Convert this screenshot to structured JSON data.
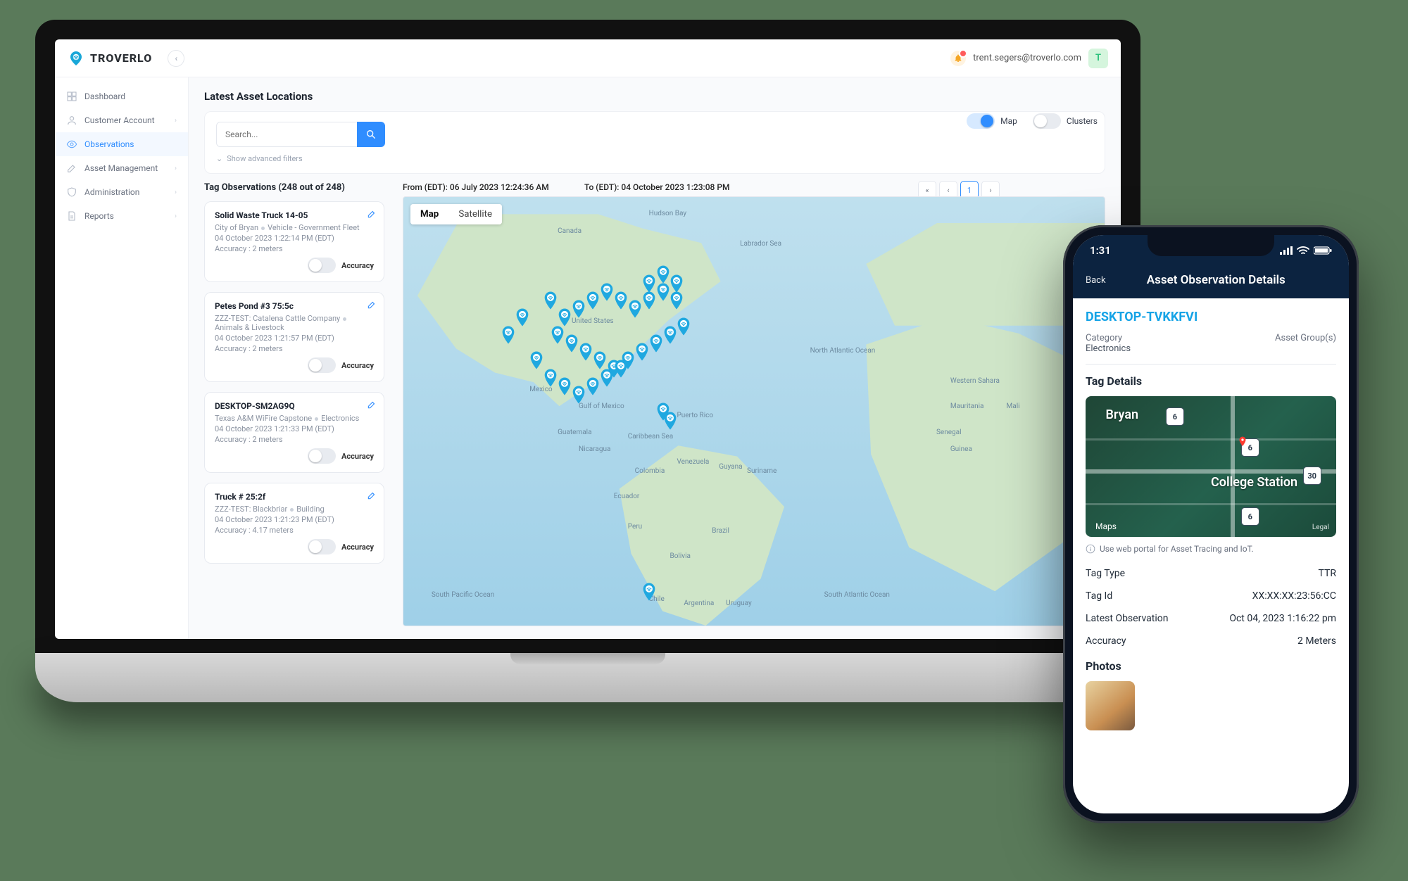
{
  "brand": "TROVERLO",
  "user": {
    "email": "trent.segers@troverlo.com",
    "initial": "T"
  },
  "sidebar": {
    "items": [
      {
        "label": "Dashboard",
        "has_sub": false
      },
      {
        "label": "Customer Account",
        "has_sub": true
      },
      {
        "label": "Observations",
        "has_sub": false
      },
      {
        "label": "Asset Management",
        "has_sub": true
      },
      {
        "label": "Administration",
        "has_sub": true
      },
      {
        "label": "Reports",
        "has_sub": true
      }
    ],
    "active_index": 2
  },
  "page": {
    "title": "Latest Asset Locations",
    "search_placeholder": "Search...",
    "advanced_filters": "Show advanced filters",
    "toggles": {
      "map": "Map",
      "clusters": "Clusters",
      "map_on": true,
      "clusters_on": false
    },
    "tag_obs_title": "Tag Observations (248 out of 248)",
    "date_from_label": "From (EDT): 06 July 2023 12:24:36 AM",
    "date_to_label": "To (EDT): 04 October 2023 1:23:08 PM",
    "pager": {
      "first": "«",
      "prev": "‹",
      "current": "1",
      "next": "›",
      "last": "»"
    },
    "map_tabs": {
      "map": "Map",
      "satellite": "Satellite"
    },
    "map_labels": [
      "Canada",
      "United States",
      "Mexico",
      "Guatemala",
      "Nicaragua",
      "Puerto Rico",
      "Venezuela",
      "Colombia",
      "Ecuador",
      "Peru",
      "Brazil",
      "Bolivia",
      "Chile",
      "Argentina",
      "Uruguay",
      "Guyana",
      "Suriname",
      "Hudson Bay",
      "Labrador Sea",
      "Gulf of Mexico",
      "Caribbean Sea",
      "North Atlantic Ocean",
      "South Atlantic Ocean",
      "South Pacific Ocean",
      "Western Sahara",
      "Mauritania",
      "Mali",
      "Senegal",
      "Guinea"
    ]
  },
  "observations": [
    {
      "title": "Solid Waste Truck 14-05",
      "org": "City of Bryan",
      "category": "Vehicle - Government Fleet",
      "time": "04 October 2023 1:22:14 PM (EDT)",
      "accuracy": "Accuracy : 2 meters"
    },
    {
      "title": "Petes Pond #3 75:5c",
      "org": "ZZZ-TEST: Catalena Cattle Company",
      "category": "Animals & Livestock",
      "time": "04 October 2023 1:21:57 PM (EDT)",
      "accuracy": "Accuracy : 2 meters"
    },
    {
      "title": "DESKTOP-SM2AG9Q",
      "org": "Texas A&M WiFire Capstone",
      "category": "Electronics",
      "time": "04 October 2023 1:21:33 PM (EDT)",
      "accuracy": "Accuracy : 2 meters"
    },
    {
      "title": "Truck # 25:2f",
      "org": "ZZZ-TEST: Blackbriar",
      "category": "Building",
      "time": "04 October 2023 1:21:23 PM (EDT)",
      "accuracy": "Accuracy : 4.17 meters"
    }
  ],
  "accuracy_label": "Accuracy",
  "mobile": {
    "time": "1:31",
    "back": "Back",
    "title": "Asset Observation Details",
    "asset": "DESKTOP-TVKKFVI",
    "meta": {
      "cat_label": "Category",
      "cat_value": "Electronics",
      "grp_label": "Asset Group(s)",
      "grp_value": ""
    },
    "section_tag_details": "Tag Details",
    "map": {
      "city1": "Bryan",
      "city2": "College Station",
      "shields": [
        "6",
        "6",
        "30",
        "6"
      ],
      "brand": "Maps",
      "legal": "Legal"
    },
    "helper": "Use web portal for Asset Tracing and IoT.",
    "rows": [
      {
        "k": "Tag Type",
        "v": "TTR"
      },
      {
        "k": "Tag Id",
        "v": "XX:XX:XX:23:56:CC"
      },
      {
        "k": "Latest Observation",
        "v": "Oct 04, 2023 1:16:22 pm"
      },
      {
        "k": "Accuracy",
        "v": "2 Meters"
      }
    ],
    "section_photos": "Photos"
  }
}
